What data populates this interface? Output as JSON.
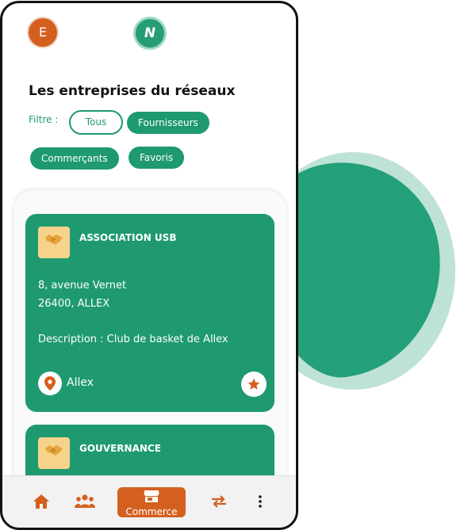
{
  "header": {
    "avatar_initial": "E",
    "logo_letter": "N"
  },
  "page": {
    "title": "Les entreprises du réseaux"
  },
  "filter": {
    "label": "Filtre :",
    "chips": [
      "Tous",
      "Fournisseurs",
      "Commerçants",
      "Favoris"
    ],
    "selected": "Tous"
  },
  "companies": [
    {
      "name": "ASSOCIATION USB",
      "address_line1": "8, avenue Vernet",
      "address_line2": "26400, ALLEX",
      "description": "Description : Club de basket de Allex",
      "city": "Allex",
      "icon": "handshake-icon"
    },
    {
      "name": "GOUVERNANCE",
      "icon": "handshake-icon"
    }
  ],
  "nav": {
    "active_label": "Commerce",
    "items": [
      "home-icon",
      "people-icon",
      "store-icon",
      "swap-icon",
      "more-icon"
    ]
  },
  "colors": {
    "primary_green": "#1f9a70",
    "accent_orange": "#d4601f",
    "blob_light": "#bfe2d6"
  }
}
